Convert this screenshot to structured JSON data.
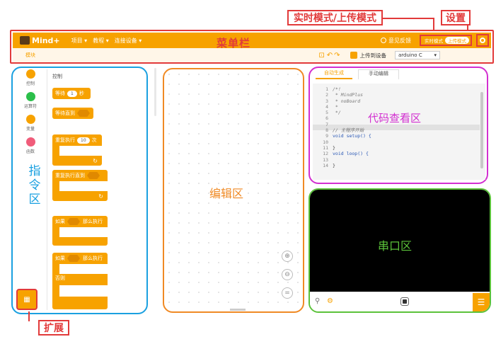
{
  "annotations": {
    "mode": "实时模式/上传模式",
    "settings": "设置",
    "menubar": "菜单栏",
    "instruction_zone": "指\n令\n区",
    "editor_zone": "编辑区",
    "code_zone": "代码查看区",
    "serial_zone": "串口区",
    "extension": "扩展"
  },
  "menu": {
    "logo": "Mind+",
    "items": [
      "项目 ▾",
      "教程 ▾",
      "连接设备 ▾"
    ],
    "feedback": "意见反馈",
    "realtime_mode": "实时模式",
    "upload_mode": "上传模式",
    "module_tab": "模块",
    "upload_device": "上传到设备",
    "board_select": "arduino C"
  },
  "categories": [
    {
      "label": "控制",
      "color": "#f7a200"
    },
    {
      "label": "运算符",
      "color": "#2bbf4a"
    },
    {
      "label": "变量",
      "color": "#f7a200"
    },
    {
      "label": "函数",
      "color": "#f05c7a"
    }
  ],
  "blocks": {
    "section_title": "控制",
    "wait": "等待",
    "wait_value": "1",
    "wait_unit": "秒",
    "wait_until": "等待直到",
    "repeat": "重复执行",
    "repeat_value": "10",
    "repeat_unit": "次",
    "repeat_until": "重复执行直到",
    "if1": "如果",
    "then1": "那么执行",
    "if2": "如果",
    "then2": "那么执行",
    "else": "否则"
  },
  "extension_label": "扩展",
  "code_tabs": [
    "自动生成",
    "手动编辑"
  ],
  "code_lines": [
    {
      "n": "1",
      "text": "/*!"
    },
    {
      "n": "2",
      "text": " * MindPlus"
    },
    {
      "n": "3",
      "text": " * noBoard"
    },
    {
      "n": "4",
      "text": " *"
    },
    {
      "n": "5",
      "text": " */"
    },
    {
      "n": "6",
      "text": ""
    },
    {
      "n": "7",
      "text": ""
    },
    {
      "n": "8",
      "text": "// 主程序开始"
    },
    {
      "n": "9",
      "text": "void setup() {"
    },
    {
      "n": "10",
      "text": ""
    },
    {
      "n": "11",
      "text": "}"
    },
    {
      "n": "12",
      "text": "void loop() {"
    },
    {
      "n": "13",
      "text": ""
    },
    {
      "n": "14",
      "text": "}"
    }
  ],
  "colors": {
    "accent": "#f7a200",
    "annotation_red": "#e23a3a",
    "instruction_blue": "#1aa0e0",
    "editor_orange": "#f08a24",
    "code_magenta": "#d22fd0",
    "serial_green": "#5bc23a"
  }
}
